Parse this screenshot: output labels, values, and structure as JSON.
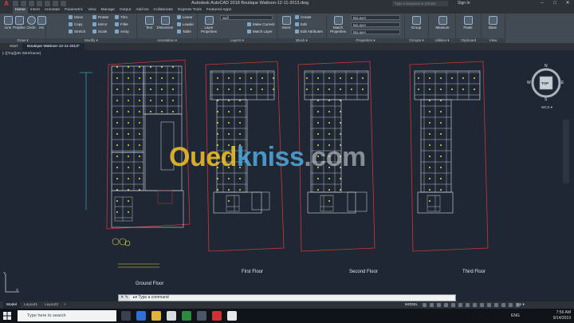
{
  "title_bar": {
    "logo": "A",
    "title": "Autodesk AutoCAD 2018    Boutique Wattoon-12-11-2013.dwg",
    "search_placeholder": "Type a keyword or phrase",
    "signin": "Sign In",
    "minimize": "–",
    "maximize": "□",
    "close": "✕"
  },
  "ribbon_tabs": [
    "Home",
    "Insert",
    "Annotate",
    "Parametric",
    "View",
    "Manage",
    "Output",
    "Add-ins",
    "Collaborate",
    "Express Tools",
    "Featured Apps"
  ],
  "ribbon": {
    "draw": {
      "title": "Draw ▾",
      "buttons": [
        "Line",
        "Polyline",
        "Circle",
        "Arc"
      ]
    },
    "modify": {
      "title": "Modify ▾",
      "rows": [
        "Move",
        "Rotate",
        "Trim",
        "Copy",
        "Mirror",
        "Fillet",
        "Stretch",
        "Scale",
        "Array"
      ]
    },
    "annotation": {
      "title": "Annotation ▾",
      "buttons": [
        "Text",
        "Dimension"
      ],
      "rows": [
        "Linear",
        "Leader",
        "Table"
      ]
    },
    "layers": {
      "title": "Layers ▾",
      "button": "Layer Properties",
      "dropdown": "walf",
      "rows": [
        "Make Current",
        "Match Layer"
      ]
    },
    "block": {
      "title": "Block ▾",
      "button": "Insert",
      "rows": [
        "Create",
        "Edit",
        "Edit Attributes"
      ]
    },
    "properties": {
      "title": "Properties ▾",
      "button": "Match Properties",
      "dropdowns": [
        "ByLayer",
        "ByLayer",
        "ByLayer"
      ]
    },
    "groups": {
      "title": "Groups ▾",
      "button": "Group"
    },
    "utilities": {
      "title": "Utilities ▾",
      "button": "Measure"
    },
    "clipboard": {
      "title": "Clipboard",
      "button": "Paste"
    },
    "view": {
      "title": "View",
      "button": "Base"
    }
  },
  "doc_tabs": [
    "Start",
    "Boutique Wattoon-12-11-2013*"
  ],
  "viewport_label": "[–][Top][2D Wireframe]",
  "floors": {
    "ground": "Ground Floor",
    "first": "First Floor",
    "second": "Second Floor",
    "third": "Third Floor"
  },
  "viewcube": {
    "n": "N",
    "s": "S",
    "e": "E",
    "w": "W",
    "face": "TOP",
    "wcs": "WCS ▾"
  },
  "watermark": {
    "part_a": "Oued",
    "part_b": "kniss",
    "part_c": ".com"
  },
  "ucs": {
    "x": "X",
    "y": "Y"
  },
  "command_line": {
    "icons": "✕ ✎",
    "prompt": "▸▾ Type a command"
  },
  "layout_tabs": [
    "Model",
    "Layout1",
    "Layout2",
    "+"
  ],
  "status": {
    "model": "MODEL",
    "scale": "1:1 ▾"
  },
  "taskbar": {
    "search_placeholder": "Type here to search",
    "time": "7:56 AM",
    "date": "9/14/2019",
    "lang": "ENG"
  },
  "colors": {
    "canvas_bg": "#1e2733",
    "ribbon_bg": "#424a54",
    "accent_red": "#e03c31",
    "cad_cyan": "#5fd3e6",
    "cad_red": "#c83a3a",
    "cad_yellow": "#e8d84a"
  }
}
